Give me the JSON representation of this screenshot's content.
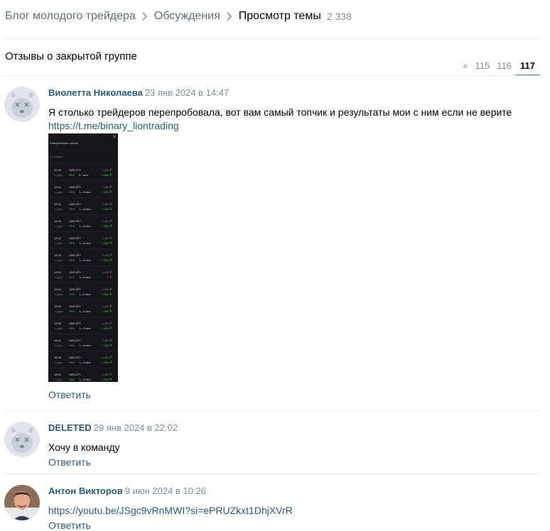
{
  "breadcrumb": {
    "items": [
      "Блог молодого трейдера",
      "Обсуждения"
    ],
    "current": "Просмотр темы",
    "count": "2 338"
  },
  "topic": {
    "title": "Отзывы о закрытой группе"
  },
  "pagination": {
    "prev": "«",
    "pages": [
      "115",
      "116"
    ],
    "current": "117"
  },
  "posts": [
    {
      "author": "Виолетта Николаева",
      "date": "23 янв 2024 в 14:47",
      "text": "Я столько трейдеров перепробовала, вот вам самый топчик и результаты мои с ним если не верите",
      "link": "https://t.me/binary_liontrading",
      "reply": "Ответить",
      "screenshot": {
        "header": "Завершённые сделки",
        "day": "22 января",
        "trades": [
          {
            "time": "20:45",
            "pair": "NZD/JPY",
            "amount": "1,000 ₽",
            "count": "1 сдел.",
            "pct": "88%",
            "duration": "5+ мин.",
            "result": "1,880 ₽",
            "win": true
          },
          {
            "time": "19:31",
            "pair": "GBP/JPY",
            "amount": "1,000 ₽",
            "count": "1 сдел.",
            "pct": "95%",
            "duration": "1—5 мин.",
            "result": "1,950 ₽",
            "win": true
          },
          {
            "time": "19:24",
            "pair": "GBP/JPY",
            "amount": "1,000 ₽",
            "count": "1 сдел.",
            "pct": "95%",
            "duration": "1—5 мин.",
            "result": "1,950 ₽",
            "win": true
          },
          {
            "time": "19:15",
            "pair": "GBP/JPY",
            "amount": "1,000 ₽",
            "count": "1 сдел.",
            "pct": "95%",
            "duration": "1—5 мин.",
            "result": "1,950 ₽",
            "win": true
          },
          {
            "time": "19:22",
            "pair": "GBP/JPY",
            "amount": "1,000 ₽",
            "count": "1 сдел.",
            "pct": "95%",
            "duration": "1—5 мин.",
            "result": "1,950 ₽",
            "win": true
          },
          {
            "time": "19:18",
            "pair": "GBP/JPY",
            "amount": "1,000 ₽",
            "count": "1 сдел.",
            "pct": "95%",
            "duration": "1—5 мин.",
            "result": "1,950 ₽",
            "win": true
          },
          {
            "time": "19:15",
            "pair": "GBP/JPY",
            "amount": "1,000 ₽",
            "count": "1 сдел.",
            "pct": "95%",
            "duration": "1—5 мин.",
            "result": "0 ₽",
            "win": false
          },
          {
            "time": "19:12",
            "pair": "GBP/JPY",
            "amount": "1,000 ₽",
            "count": "1 сдел.",
            "pct": "95%",
            "duration": "1—5 мин.",
            "result": "1,950 ₽",
            "win": true
          },
          {
            "time": "19:09",
            "pair": "GBP/JPY",
            "amount": "1,000 ₽",
            "count": "1 сдел.",
            "pct": "95%",
            "duration": "1—5 мин.",
            "result": "1,950 ₽",
            "win": true
          },
          {
            "time": "19:06",
            "pair": "GBP/JPY",
            "amount": "1,000 ₽",
            "count": "1 сдел.",
            "pct": "95%",
            "duration": "1—5 мин.",
            "result": "1,950 ₽",
            "win": true
          },
          {
            "time": "16:11",
            "pair": "NZD/JPY",
            "amount": "1,000 ₽",
            "count": "1 сдел.",
            "pct": "95%",
            "duration": "1—5 мин.",
            "result": "1,950 ₽",
            "win": true
          },
          {
            "time": "16:08",
            "pair": "NZD/JPY",
            "amount": "1,000 ₽",
            "count": "1 сдел.",
            "pct": "95%",
            "duration": "1—5 мин.",
            "result": "1,950 ₽",
            "win": true
          },
          {
            "time": "16:04",
            "pair": "NZD/JPY",
            "amount": "1,000 ₽",
            "count": "1 сдел.",
            "pct": "95%",
            "duration": "1—5 мин.",
            "result": "1,950 ₽",
            "win": true
          }
        ]
      }
    },
    {
      "author": "DELETED",
      "date": "29 янв 2024 в 22:02",
      "text": "Хочу в команду",
      "reply": "Ответить"
    },
    {
      "author": "Антон Викторов",
      "date": "9 июн 2024 в 10:26",
      "link": "https://youtu.be/JSgc9vRnMWI?si=ePRUZkxt1DhjXVrR",
      "reply": "Ответить"
    }
  ],
  "colors": {
    "link": "#2a5885",
    "muted": "#818c99",
    "accent": "#5181b8",
    "divider": "#e7e8ec"
  },
  "icons": [
    "chevron-right-icon",
    "deactivated-dog-avatar-icon",
    "user-photo-avatar"
  ]
}
